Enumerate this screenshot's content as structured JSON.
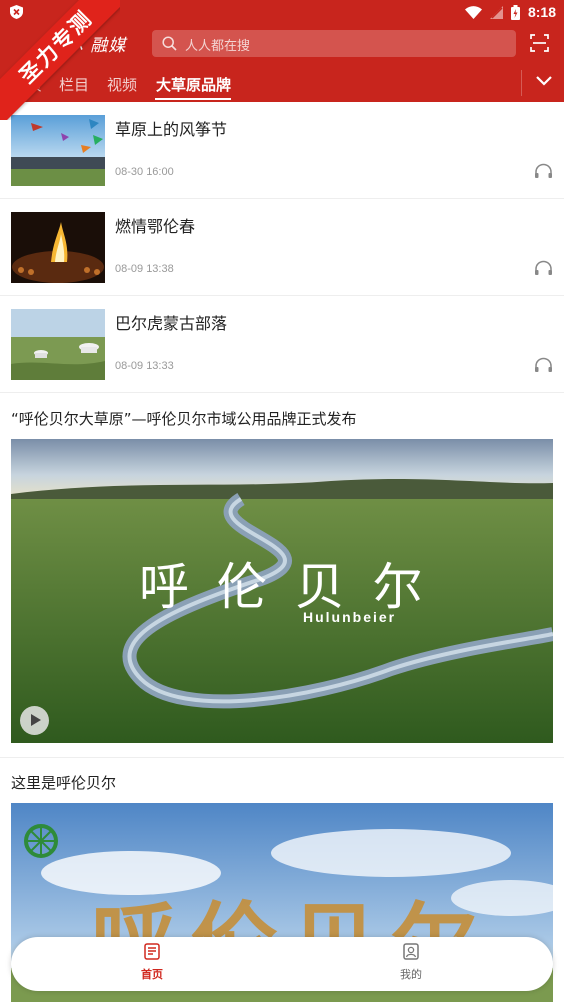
{
  "status_bar": {
    "time": "8:18"
  },
  "header": {
    "logo_text": "…尔 融媒",
    "search": {
      "placeholder": "人人都在搜"
    }
  },
  "ribbon": {
    "text": "圣力专测"
  },
  "tabs": [
    {
      "label": "首页",
      "active": false
    },
    {
      "label": "栏目",
      "active": false
    },
    {
      "label": "视频",
      "active": false
    },
    {
      "label": "大草原品牌",
      "active": true
    }
  ],
  "news_items": [
    {
      "title": "草原上的风筝节",
      "time": "08-30 16:00"
    },
    {
      "title": "燃情鄂伦春",
      "time": "08-09 13:38"
    },
    {
      "title": "巴尔虎蒙古部落",
      "time": "08-09 13:33"
    }
  ],
  "video_article": {
    "title": "“呼伦贝尔大草原”—呼伦贝尔市域公用品牌正式发布",
    "overlay_cn": "呼 伦 贝 尔",
    "overlay_en": "Hulunbeier"
  },
  "article2": {
    "title": "这里是呼伦贝尔",
    "overlay_cn": "呼伦贝尔"
  },
  "bottom_nav": [
    {
      "label": "首页",
      "icon": "home-icon",
      "active": true
    },
    {
      "label": "我的",
      "icon": "profile-icon",
      "active": false
    }
  ],
  "colors": {
    "brand_red": "#c8251d",
    "ribbon_red": "#e0231b",
    "active_nav": "#d0281f"
  }
}
